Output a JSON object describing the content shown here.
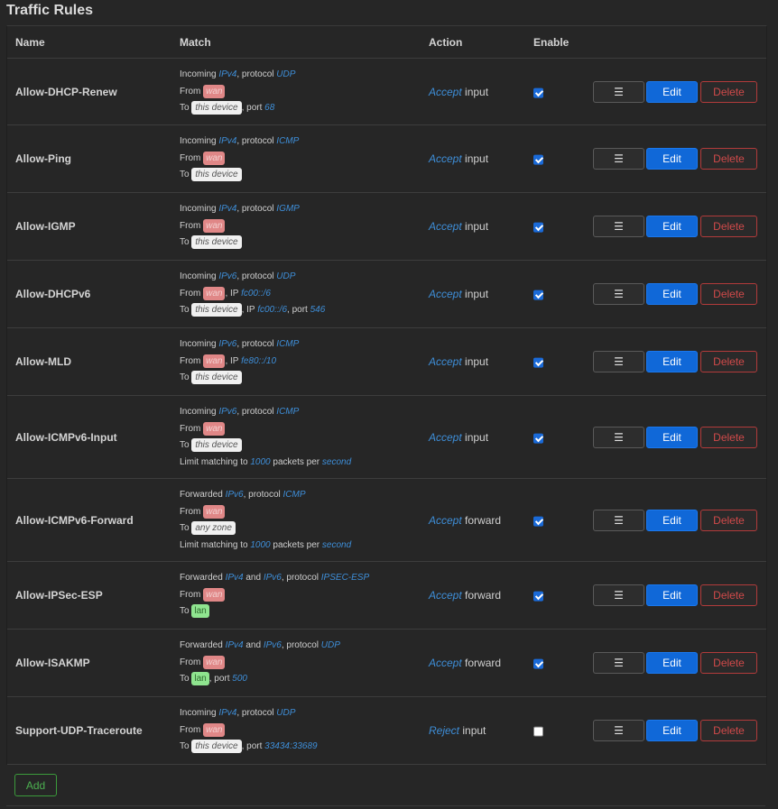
{
  "page": {
    "title": "Traffic Rules"
  },
  "columns": {
    "name": "Name",
    "match": "Match",
    "action": "Action",
    "enable": "Enable"
  },
  "buttons": {
    "menu": "☰",
    "edit": "Edit",
    "delete": "Delete",
    "add": "Add"
  },
  "rules": [
    {
      "name": "Allow-DHCP-Renew",
      "match": [
        [
          {
            "t": "Incoming "
          },
          {
            "v": "IPv4"
          },
          {
            "t": ", protocol "
          },
          {
            "v": "UDP"
          }
        ],
        [
          {
            "t": "From "
          },
          {
            "tag": "wan",
            "k": "wan"
          }
        ],
        [
          {
            "t": "To "
          },
          {
            "tag": "this device",
            "k": "dev"
          },
          {
            "t": ", port "
          },
          {
            "v": "68"
          }
        ]
      ],
      "action_verb": "Accept",
      "action_target": "input",
      "enabled": true
    },
    {
      "name": "Allow-Ping",
      "match": [
        [
          {
            "t": "Incoming "
          },
          {
            "v": "IPv4"
          },
          {
            "t": ", protocol "
          },
          {
            "v": "ICMP"
          }
        ],
        [
          {
            "t": "From "
          },
          {
            "tag": "wan",
            "k": "wan"
          }
        ],
        [
          {
            "t": "To "
          },
          {
            "tag": "this device",
            "k": "dev"
          }
        ]
      ],
      "action_verb": "Accept",
      "action_target": "input",
      "enabled": true
    },
    {
      "name": "Allow-IGMP",
      "match": [
        [
          {
            "t": "Incoming "
          },
          {
            "v": "IPv4"
          },
          {
            "t": ", protocol "
          },
          {
            "v": "IGMP"
          }
        ],
        [
          {
            "t": "From "
          },
          {
            "tag": "wan",
            "k": "wan"
          }
        ],
        [
          {
            "t": "To "
          },
          {
            "tag": "this device",
            "k": "dev"
          }
        ]
      ],
      "action_verb": "Accept",
      "action_target": "input",
      "enabled": true
    },
    {
      "name": "Allow-DHCPv6",
      "match": [
        [
          {
            "t": "Incoming "
          },
          {
            "v": "IPv6"
          },
          {
            "t": ", protocol "
          },
          {
            "v": "UDP"
          }
        ],
        [
          {
            "t": "From "
          },
          {
            "tag": "wan",
            "k": "wan"
          },
          {
            "t": ", IP "
          },
          {
            "v": "fc00::/6"
          }
        ],
        [
          {
            "t": "To "
          },
          {
            "tag": "this device",
            "k": "dev"
          },
          {
            "t": ", IP "
          },
          {
            "v": "fc00::/6"
          },
          {
            "t": ", port "
          },
          {
            "v": "546"
          }
        ]
      ],
      "action_verb": "Accept",
      "action_target": "input",
      "enabled": true
    },
    {
      "name": "Allow-MLD",
      "match": [
        [
          {
            "t": "Incoming "
          },
          {
            "v": "IPv6"
          },
          {
            "t": ", protocol "
          },
          {
            "v": "ICMP"
          }
        ],
        [
          {
            "t": "From "
          },
          {
            "tag": "wan",
            "k": "wan"
          },
          {
            "t": ", IP "
          },
          {
            "v": "fe80::/10"
          }
        ],
        [
          {
            "t": "To "
          },
          {
            "tag": "this device",
            "k": "dev"
          }
        ]
      ],
      "action_verb": "Accept",
      "action_target": "input",
      "enabled": true
    },
    {
      "name": "Allow-ICMPv6-Input",
      "match": [
        [
          {
            "t": "Incoming "
          },
          {
            "v": "IPv6"
          },
          {
            "t": ", protocol "
          },
          {
            "v": "ICMP"
          }
        ],
        [
          {
            "t": "From "
          },
          {
            "tag": "wan",
            "k": "wan"
          }
        ],
        [
          {
            "t": "To "
          },
          {
            "tag": "this device",
            "k": "dev"
          }
        ],
        [
          {
            "t": "Limit matching to "
          },
          {
            "v": "1000"
          },
          {
            "t": " packets per "
          },
          {
            "v": "second"
          }
        ]
      ],
      "action_verb": "Accept",
      "action_target": "input",
      "enabled": true
    },
    {
      "name": "Allow-ICMPv6-Forward",
      "match": [
        [
          {
            "t": "Forwarded "
          },
          {
            "v": "IPv6"
          },
          {
            "t": ", protocol "
          },
          {
            "v": "ICMP"
          }
        ],
        [
          {
            "t": "From "
          },
          {
            "tag": "wan",
            "k": "wan"
          }
        ],
        [
          {
            "t": "To "
          },
          {
            "tag": "any zone",
            "k": "dev"
          }
        ],
        [
          {
            "t": "Limit matching to "
          },
          {
            "v": "1000"
          },
          {
            "t": " packets per "
          },
          {
            "v": "second"
          }
        ]
      ],
      "action_verb": "Accept",
      "action_target": "forward",
      "enabled": true
    },
    {
      "name": "Allow-IPSec-ESP",
      "match": [
        [
          {
            "t": "Forwarded "
          },
          {
            "v": "IPv4"
          },
          {
            "t": " and "
          },
          {
            "v": "IPv6"
          },
          {
            "t": ", protocol "
          },
          {
            "v": "IPSEC-ESP"
          }
        ],
        [
          {
            "t": "From "
          },
          {
            "tag": "wan",
            "k": "wan"
          }
        ],
        [
          {
            "t": "To "
          },
          {
            "tag": "lan",
            "k": "lan"
          }
        ]
      ],
      "action_verb": "Accept",
      "action_target": "forward",
      "enabled": true
    },
    {
      "name": "Allow-ISAKMP",
      "match": [
        [
          {
            "t": "Forwarded "
          },
          {
            "v": "IPv4"
          },
          {
            "t": " and "
          },
          {
            "v": "IPv6"
          },
          {
            "t": ", protocol "
          },
          {
            "v": "UDP"
          }
        ],
        [
          {
            "t": "From "
          },
          {
            "tag": "wan",
            "k": "wan"
          }
        ],
        [
          {
            "t": "To "
          },
          {
            "tag": "lan",
            "k": "lan"
          },
          {
            "t": ", port "
          },
          {
            "v": "500"
          }
        ]
      ],
      "action_verb": "Accept",
      "action_target": "forward",
      "enabled": true
    },
    {
      "name": "Support-UDP-Traceroute",
      "match": [
        [
          {
            "t": "Incoming "
          },
          {
            "v": "IPv4"
          },
          {
            "t": ", protocol "
          },
          {
            "v": "UDP"
          }
        ],
        [
          {
            "t": "From "
          },
          {
            "tag": "wan",
            "k": "wan"
          }
        ],
        [
          {
            "t": "To "
          },
          {
            "tag": "this device",
            "k": "dev"
          },
          {
            "t": ", port "
          },
          {
            "v": "33434:33689"
          }
        ]
      ],
      "action_verb": "Reject",
      "action_target": "input",
      "enabled": false
    }
  ]
}
